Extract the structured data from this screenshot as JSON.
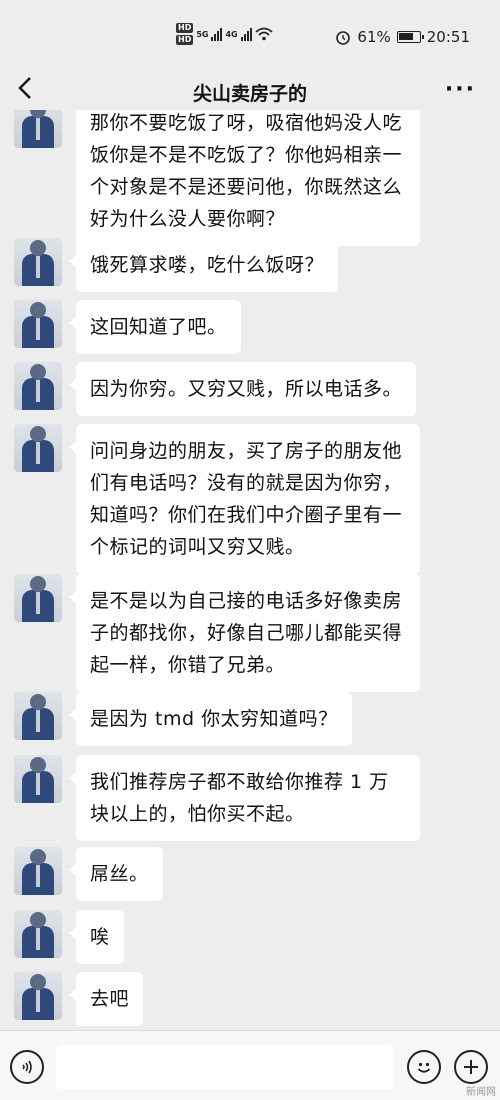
{
  "status_bar": {
    "hd1": "HD",
    "hd2": "HD",
    "net1": "5G",
    "net2": "4G",
    "battery_percent": "61%",
    "time": "20:51"
  },
  "nav": {
    "title": "尖山卖房子的",
    "more": "···"
  },
  "messages": [
    {
      "text": "那你不要吃饭了呀，吸宿他妈没人吃饭你是不是不吃饭了？你他妈相亲一个对象是不是还要问他，你既然这么好为什么没人要你啊？"
    },
    {
      "text": "饿死算求喽，吃什么饭呀？"
    },
    {
      "text": "这回知道了吧。"
    },
    {
      "text": "因为你穷。又穷又贱，所以电话多。"
    },
    {
      "text": "问问身边的朋友，买了房子的朋友他们有电话吗？没有的就是因为你穷，知道吗？你们在我们中介圈子里有一个标记的词叫又穷又贱。"
    },
    {
      "text": "是不是以为自己接的电话多好像卖房子的都找你，好像自己哪儿都能买得起一样，你错了兄弟。"
    },
    {
      "text": "是因为 tmd 你太穷知道吗？"
    },
    {
      "text": "我们推荐房子都不敢给你推荐 1 万块以上的，怕你买不起。"
    },
    {
      "text": "屌丝。"
    },
    {
      "text": "唉"
    },
    {
      "text": "去吧"
    }
  ],
  "input_bar": {
    "placeholder": ""
  },
  "watermark": "新闻网"
}
